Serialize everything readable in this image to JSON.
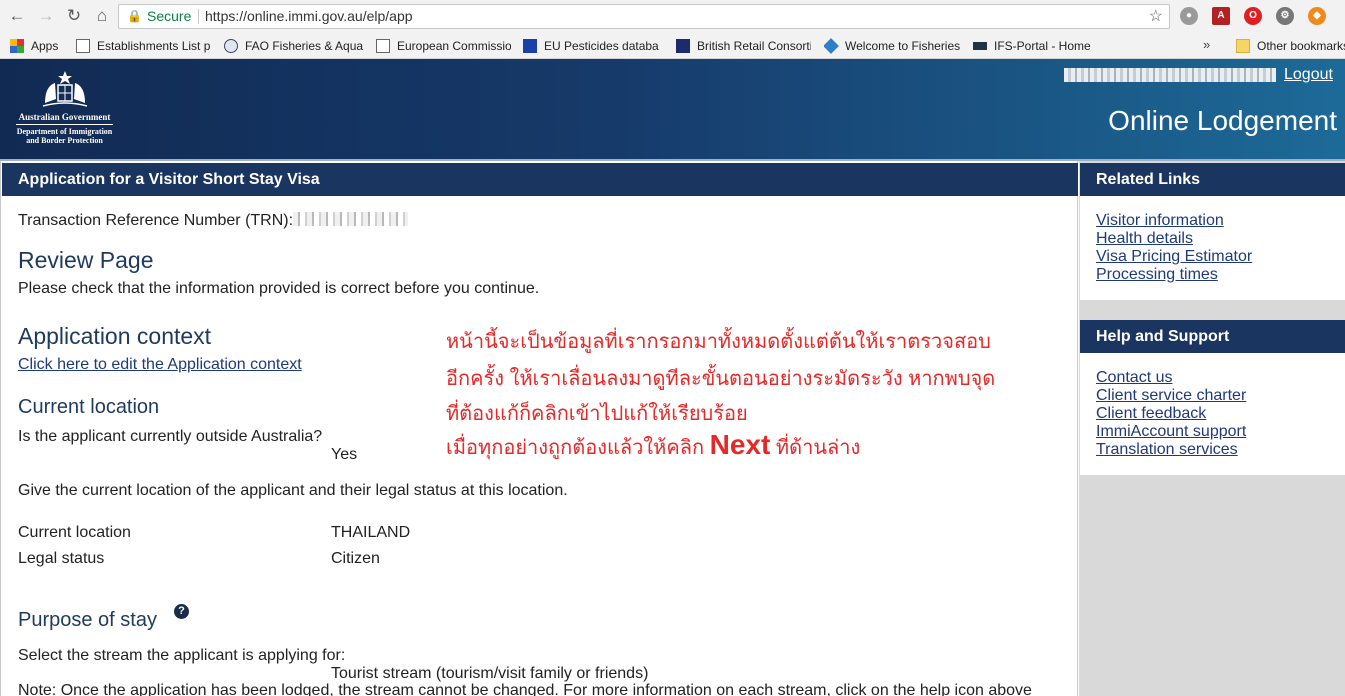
{
  "browser": {
    "secure_label": "Secure",
    "url": "https://online.immi.gov.au/elp/app",
    "bookmarks": [
      {
        "label": "Apps",
        "icon": "apps-grid-icon"
      },
      {
        "label": "Establishments List p",
        "icon": "page-icon"
      },
      {
        "label": "FAO Fisheries & Aqua",
        "icon": "globe-icon"
      },
      {
        "label": "European Commissio",
        "icon": "page-icon"
      },
      {
        "label": "EU Pesticides databa",
        "icon": "eu-flag-icon"
      },
      {
        "label": "British Retail Consorti",
        "icon": "brc-icon"
      },
      {
        "label": "Welcome to Fisheries",
        "icon": "fish-icon"
      },
      {
        "label": "IFS-Portal - Home",
        "icon": "ifs-icon"
      }
    ],
    "more_bookmarks": "»",
    "other_bookmarks": "Other bookmarks"
  },
  "header": {
    "gov_line": "Australian Government",
    "dept_line1": "Department of Immigration",
    "dept_line2": "and Border Protection",
    "logout": "Logout",
    "app_title": "Online Lodgement"
  },
  "main": {
    "heading": "Application for a Visitor Short Stay Visa",
    "trn_label": "Transaction Reference Number (TRN):",
    "review_title": "Review Page",
    "review_desc": "Please check that the information provided is correct before you continue.",
    "context_title": "Application context",
    "context_link": "Click here to edit the Application context",
    "location_title": "Current location",
    "outside_q": "Is the applicant currently outside Australia?",
    "outside_a": "Yes",
    "location_desc": "Give the current location of the applicant and their legal status at this location.",
    "location_label": "Current location",
    "location_value": "THAILAND",
    "status_label": "Legal status",
    "status_value": "Citizen",
    "purpose_title": "Purpose of stay",
    "stream_q": "Select the stream the applicant is applying for:",
    "stream_a": "Tourist stream (tourism/visit family or friends)",
    "note": "Note: Once the application has been lodged, the stream cannot be changed. For more information on each stream, click on the help icon above"
  },
  "annotation": {
    "line1": "หน้านี้จะเป็นข้อมูลที่เรากรอกมาทั้งหมดตั้งแต่ต้นให้เราตรวจสอบ",
    "line2": "อีกครั้ง ให้เราเลื่อนลงมาดูทีละขั้นตอนอย่างระมัดระวัง หากพบจุด",
    "line3": "ที่ต้องแก้ก็คลิกเข้าไปแก้ให้เรียบร้อย",
    "line4_pre": "เมื่อทุกอย่างถูกต้องแล้วให้คลิก ",
    "line4_next": "Next",
    "line4_post": " ที่ด้านล่าง",
    "color": "#e62828"
  },
  "sidebar": {
    "related_title": "Related Links",
    "related_links": [
      "Visitor information",
      "Health details",
      "Visa Pricing Estimator",
      "Processing times"
    ],
    "help_title": "Help and Support",
    "help_links": [
      "Contact us",
      "Client service charter",
      "Client feedback",
      "ImmiAccount support",
      "Translation services"
    ]
  },
  "colors": {
    "header_dark": "#112a53",
    "header_light": "#1d6a98",
    "panel_heading": "#1b3561",
    "link": "#1f3a7a"
  }
}
